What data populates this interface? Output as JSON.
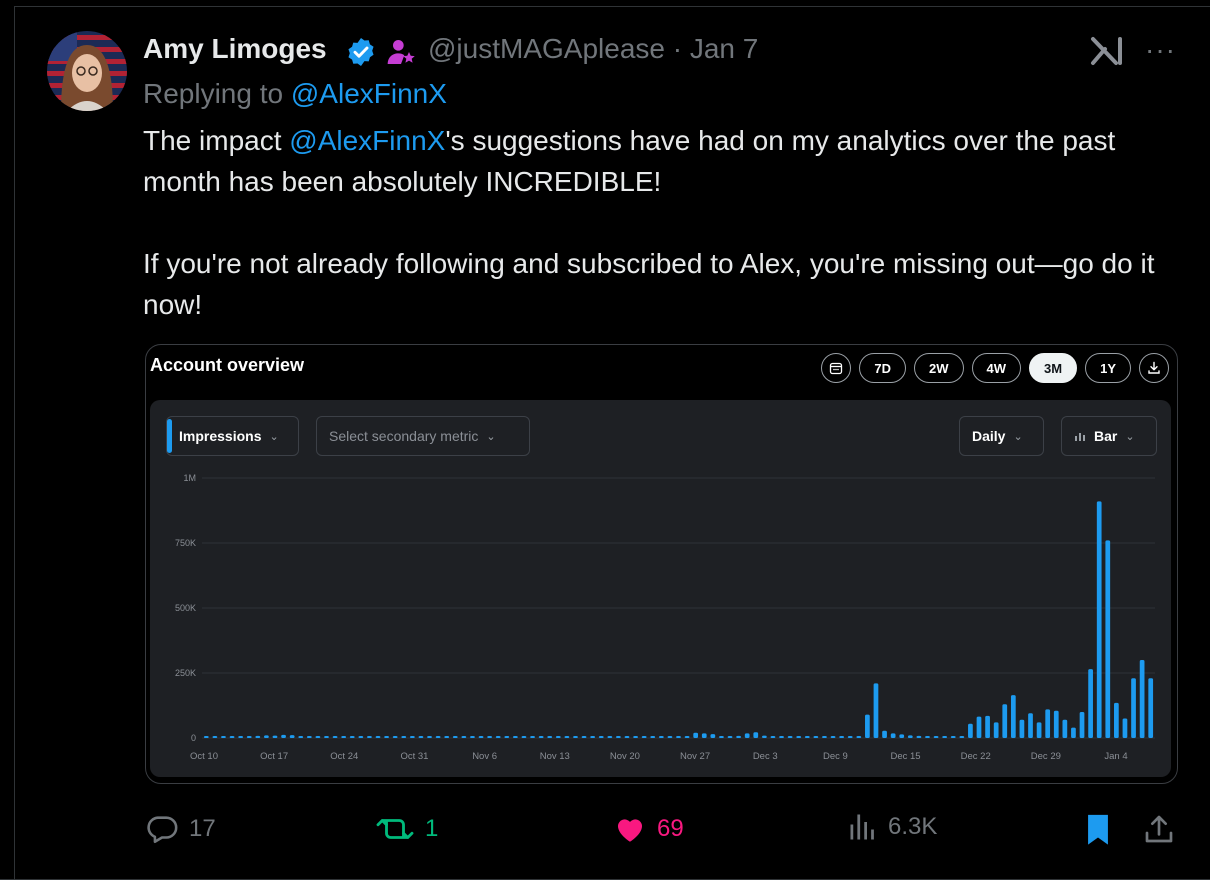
{
  "tweet": {
    "author_name": "Amy Limoges",
    "handle_date": "@justMAGAplease · Jan 7",
    "replying_prefix": "Replying to ",
    "replying_to": "@AlexFinnX",
    "body_p1_before": "The impact ",
    "body_p1_mention": "@AlexFinnX",
    "body_p1_after": "'s suggestions have had on my analytics over the past month has been absolutely INCREDIBLE!",
    "body_p2": "If you're not already following and subscribed to Alex, you're missing out—go do it now!",
    "more_label": "···"
  },
  "analytics": {
    "title": "Account overview",
    "ranges": [
      "7D",
      "2W",
      "4W",
      "3M",
      "1Y"
    ],
    "active_range": "3M",
    "metric": "Impressions",
    "secondary_placeholder": "Select secondary metric",
    "interval": "Daily",
    "chart_kind_label": "Bar"
  },
  "chart_data": {
    "type": "bar",
    "title": "",
    "series": [
      {
        "name": "Impressions",
        "values": [
          2000,
          2000,
          2000,
          2000,
          2000,
          2000,
          8000,
          10000,
          9000,
          12000,
          11000,
          4000,
          3000,
          2000,
          2000,
          2000,
          2000,
          2000,
          2000,
          2000,
          2000,
          2000,
          2000,
          2000,
          2000,
          2000,
          2000,
          2000,
          2000,
          2000,
          2000,
          2000,
          2000,
          2000,
          2000,
          2000,
          2000,
          2000,
          4000,
          5000,
          4000,
          2000,
          2000,
          2000,
          2000,
          2000,
          2000,
          2000,
          2000,
          2000,
          2000,
          2000,
          2000,
          2000,
          2000,
          3000,
          4000,
          20000,
          18000,
          15000,
          4000,
          4000,
          8000,
          18000,
          22000,
          9000,
          4000,
          3000,
          3000,
          3000,
          3000,
          3000,
          3000,
          3000,
          3000,
          4000,
          7000,
          90000,
          210000,
          28000,
          18000,
          14000,
          10000,
          8000,
          6000,
          5000,
          4000,
          4000,
          3000,
          55000,
          82000,
          85000,
          60000,
          130000,
          165000,
          70000,
          95000,
          60000,
          110000,
          105000,
          70000,
          40000,
          100000,
          265000,
          910000,
          760000,
          135000,
          75000,
          230000,
          300000,
          230000
        ]
      }
    ],
    "x_labels": [
      "Oct 10",
      "Oct 17",
      "Oct 24",
      "Oct 31",
      "Nov 6",
      "Nov 13",
      "Nov 20",
      "Nov 27",
      "Dec 3",
      "Dec 9",
      "Dec 15",
      "Dec 22",
      "Dec 29",
      "Jan 4"
    ],
    "y_ticks": [
      "0",
      "250K",
      "500K",
      "750K",
      "1M"
    ],
    "ylim": [
      0,
      1000000
    ],
    "grid": true,
    "color": "#1d9bf0"
  },
  "actions": {
    "replies": "17",
    "reposts": "1",
    "likes": "69",
    "views": "6.3K"
  },
  "colors": {
    "accent": "#1d9bf0",
    "repost": "#00ba7c",
    "like": "#f91880",
    "verified_badge": "#1d9bf0",
    "affiliate_badge": "#c53dd3"
  }
}
